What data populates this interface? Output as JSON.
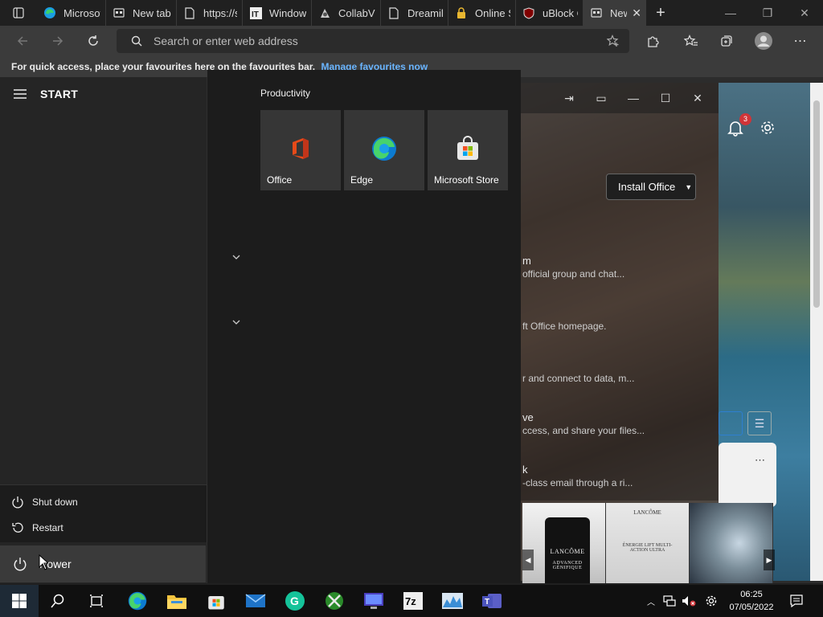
{
  "browser": {
    "tabs": [
      {
        "label": "Microsof",
        "icon": "edge-icon"
      },
      {
        "label": "New tab",
        "icon": "newtab-icon"
      },
      {
        "label": "https://s",
        "icon": "page-icon"
      },
      {
        "label": "Window",
        "icon": "windows-site-icon"
      },
      {
        "label": "CollabVM",
        "icon": "collabvm-icon"
      },
      {
        "label": "Dreamily",
        "icon": "page-icon"
      },
      {
        "label": "Online S",
        "icon": "lock-icon"
      },
      {
        "label": "uBlock O",
        "icon": "ublock-icon"
      },
      {
        "label": "New",
        "icon": "newtab-icon",
        "active": true
      }
    ],
    "address_placeholder": "Search or enter web address",
    "favbar_text": "For quick access, place your favourites here on the favourites bar.",
    "favbar_link": "Manage favourites now"
  },
  "page": {
    "notification_count": "3",
    "install_button": "Install Office",
    "items": [
      {
        "title": "m",
        "desc": "official group and chat..."
      },
      {
        "title": "",
        "desc": "ft Office homepage."
      },
      {
        "title": "",
        "desc": "r and connect to data, m..."
      },
      {
        "title": "ve",
        "desc": "ccess, and share your files..."
      },
      {
        "title": "k",
        "desc": "-class email through a ri..."
      }
    ],
    "ads": {
      "brand": "LANCÔME",
      "product1": "ADVANCED GÉNIFIQUE",
      "product2": "ÉNERGIE LIFT MULTI-ACTION ULTRA"
    }
  },
  "start_menu": {
    "title": "START",
    "group": "Productivity",
    "tiles": [
      {
        "label": "Office",
        "icon": "office-icon"
      },
      {
        "label": "Edge",
        "icon": "edge-icon"
      },
      {
        "label": "Microsoft Store",
        "icon": "store-icon"
      }
    ],
    "power_options": [
      {
        "label": "Shut down",
        "icon": "power-icon"
      },
      {
        "label": "Restart",
        "icon": "restart-icon"
      }
    ],
    "power_label": "Power"
  },
  "taskbar": {
    "apps": [
      "search-icon",
      "task-view-icon",
      "edge-icon",
      "file-explorer-icon",
      "store-icon",
      "mail-icon",
      "grammarly-icon",
      "xbox-icon",
      "monitor-app-icon",
      "7zip-icon",
      "chart-app-icon",
      "teams-icon"
    ],
    "time": "06:25",
    "date": "07/05/2022"
  },
  "colors": {
    "accent": "#0078d4",
    "link": "#6ab5ff",
    "badge": "#d13438"
  }
}
